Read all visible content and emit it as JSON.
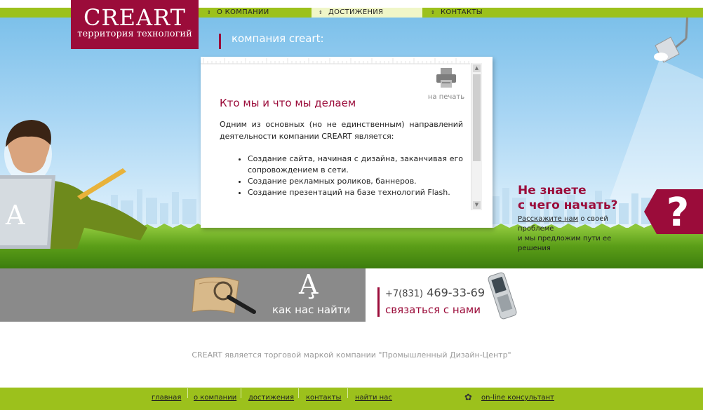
{
  "logo": {
    "name": "CREART",
    "tagline": "территория технологий"
  },
  "topnav": [
    {
      "label": "О КОМПАНИИ"
    },
    {
      "label": "ДОСТИЖЕНИЯ"
    },
    {
      "label": "КОНТАКТЫ"
    }
  ],
  "section": {
    "title": "компания creart:"
  },
  "card": {
    "print_label": "на печать",
    "heading": "Кто мы и что мы делаем",
    "intro": "Одним из основных (но не единственным) направлений деятельности компании CREART является:",
    "items": [
      "Создание сайта, начиная с дизайна, заканчивая его сопровождением в сети.",
      "Создание рекламных роликов, баннеров.",
      "Создание презентаций на базе технологий Flash."
    ]
  },
  "ask": {
    "title_line1": "Не знаете",
    "title_line2": "с чего начать?",
    "link": "Расскажите нам",
    "text1": " о своей проблеме",
    "text2": "и мы предложим пути ее решения",
    "mark": "?"
  },
  "find": {
    "label": "как нас найти"
  },
  "contact": {
    "phone_code": "+7(831)",
    "phone_number": " 469-33-69",
    "link": "связаться с нами"
  },
  "copyright": "CREART является торговой маркой компании \"Промышленный Дизайн-Центр\"",
  "footer": {
    "links": [
      "главная",
      "о компании",
      "достижения",
      "контакты",
      "найти нас"
    ],
    "consultant": "on-line консультант"
  },
  "colors": {
    "brand": "#9b0c3a",
    "green": "#9cc11c",
    "sky": "#7cc0ea"
  }
}
